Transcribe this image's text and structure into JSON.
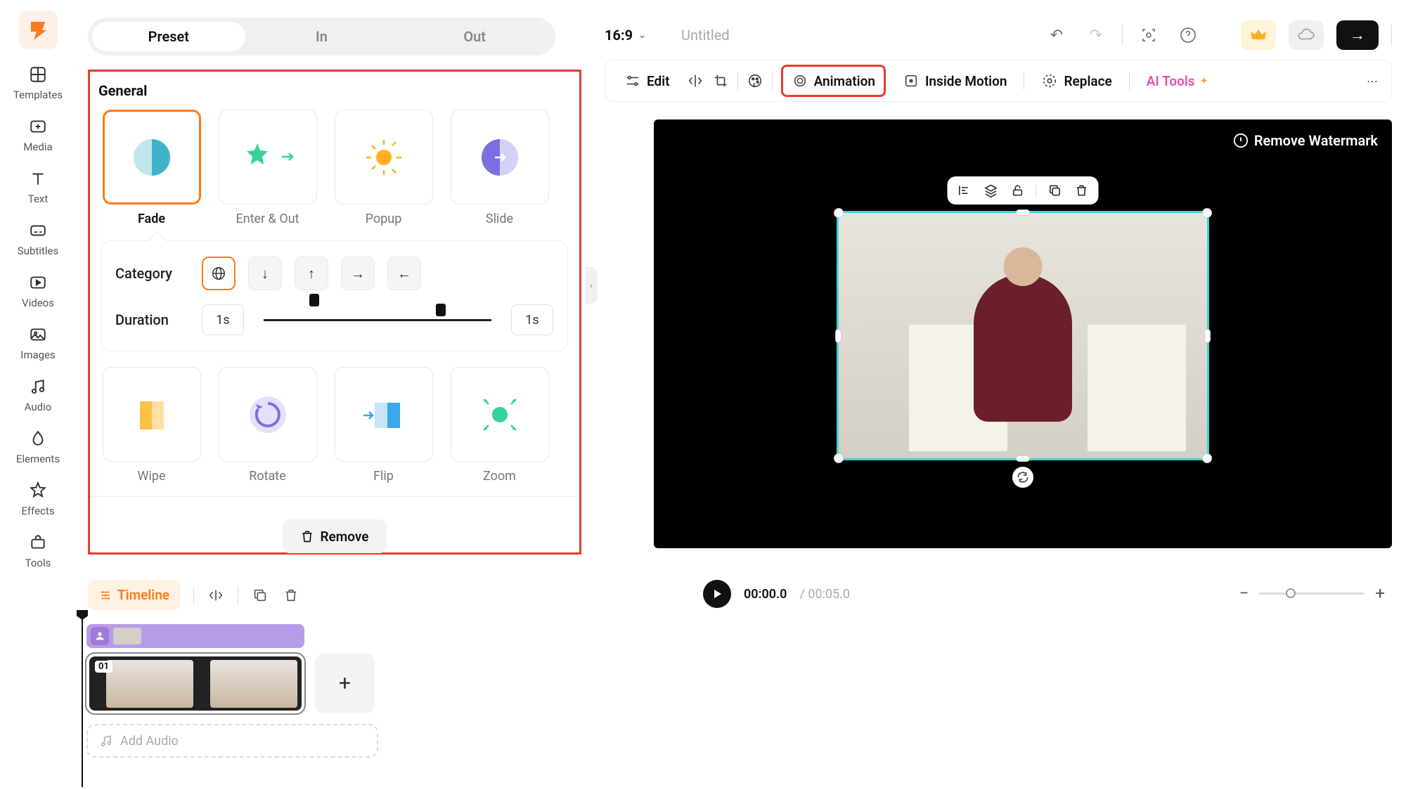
{
  "sidebar": {
    "items": [
      "Templates",
      "Media",
      "Text",
      "Subtitles",
      "Videos",
      "Images",
      "Audio",
      "Elements",
      "Effects",
      "Tools"
    ]
  },
  "tabs": {
    "preset": "Preset",
    "in": "In",
    "out": "Out"
  },
  "section": {
    "general": "General"
  },
  "presets": {
    "row1": [
      "Fade",
      "Enter & Out",
      "Popup",
      "Slide"
    ],
    "row2": [
      "Wipe",
      "Rotate",
      "Flip",
      "Zoom"
    ]
  },
  "options": {
    "category_label": "Category",
    "duration_label": "Duration",
    "duration_left": "1s",
    "duration_right": "1s"
  },
  "remove_label": "Remove",
  "topbar": {
    "ratio": "16:9",
    "title": "Untitled"
  },
  "toolbar": {
    "edit": "Edit",
    "animation": "Animation",
    "inside_motion": "Inside Motion",
    "replace": "Replace",
    "ai_tools": "AI Tools"
  },
  "preview": {
    "watermark": "Remove Watermark"
  },
  "playback": {
    "current": "00:00.0",
    "total": "00:05.0"
  },
  "timeline": {
    "label": "Timeline",
    "clip_number": "01",
    "add_audio": "Add Audio"
  }
}
